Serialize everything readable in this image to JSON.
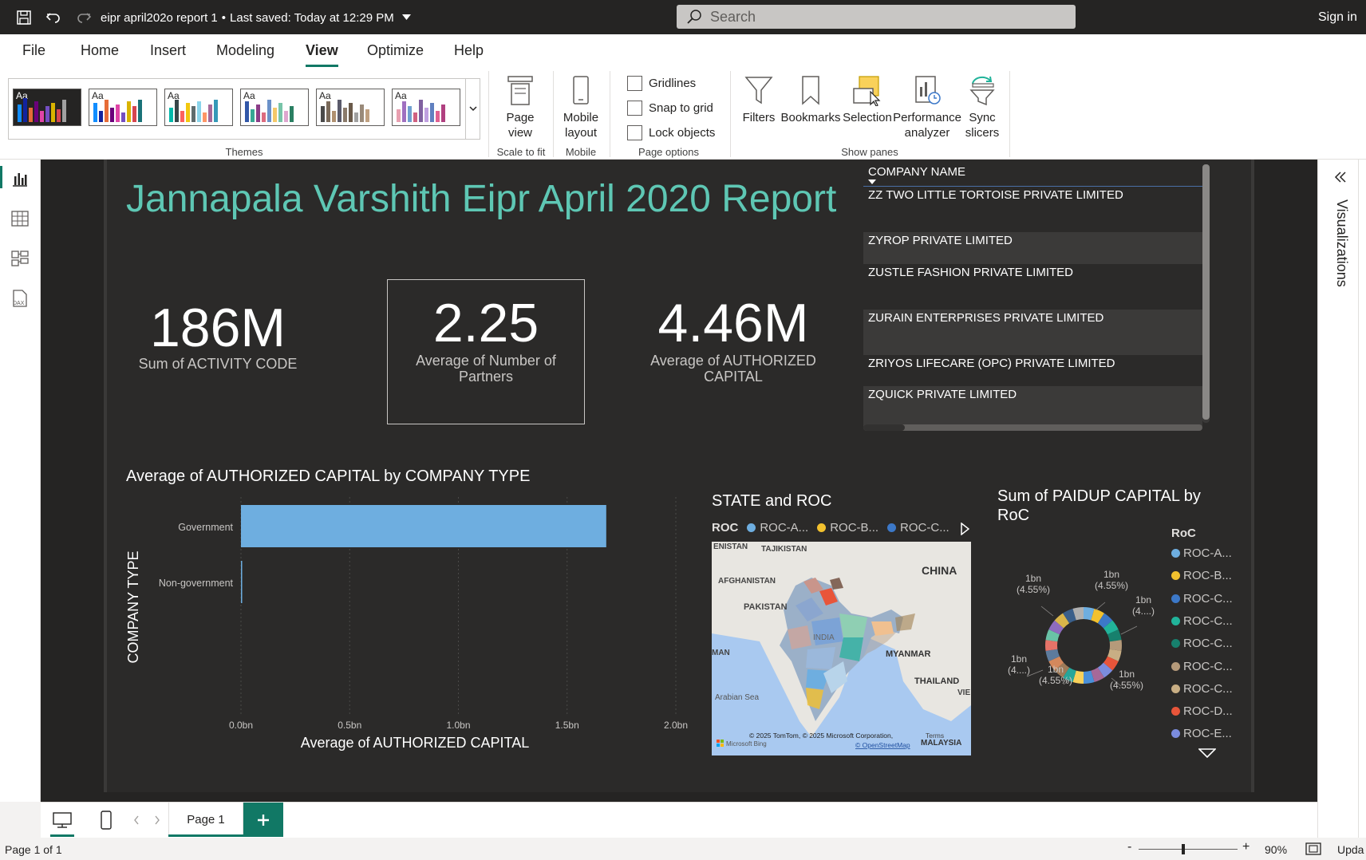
{
  "titlebar": {
    "file_title": "eipr april202o report 1",
    "saved": "Last saved: Today at 12:29 PM",
    "search_placeholder": "Search",
    "sign_in": "Sign in"
  },
  "menu": [
    "File",
    "Home",
    "Insert",
    "Modeling",
    "View",
    "Optimize",
    "Help"
  ],
  "menu_active": "View",
  "ribbon": {
    "themes_label": "Themes",
    "theme_aa": "Aa",
    "page_view": "Page view",
    "scale_to_fit": "Scale to fit",
    "mobile_layout": "Mobile layout",
    "mobile": "Mobile",
    "gridlines": "Gridlines",
    "snap_to_grid": "Snap to grid",
    "lock_objects": "Lock objects",
    "page_options": "Page options",
    "filters": "Filters",
    "bookmarks": "Bookmarks",
    "selection": "Selection",
    "performance": "Performance analyzer",
    "sync_slicers": "Sync slicers",
    "show_panes": "Show panes"
  },
  "report": {
    "title": "Jannapala Varshith Eipr April 2020 Report",
    "kpis": [
      {
        "value": "186M",
        "label": "Sum of ACTIVITY CODE"
      },
      {
        "value": "2.25",
        "label": "Average of Number of Partners"
      },
      {
        "value": "4.46M",
        "label": "Average of AUTHORIZED CAPITAL"
      }
    ],
    "table": {
      "header": "COMPANY NAME",
      "rows": [
        "ZZ TWO LITTLE TORTOISE PRIVATE LIMITED",
        "ZYROP PRIVATE LIMITED",
        "ZUSTLE FASHION PRIVATE LIMITED",
        "ZURAIN ENTERPRISES PRIVATE LIMITED",
        "ZRIYOS LIFECARE (OPC) PRIVATE LIMITED",
        "ZQUICK PRIVATE LIMITED"
      ]
    },
    "map": {
      "title": "STATE and ROC",
      "legend_title": "ROC",
      "legend": [
        "ROC-A...",
        "ROC-B...",
        "ROC-C..."
      ],
      "labels": [
        "ENISTAN",
        "TAJIKISTAN",
        "CHINA",
        "AFGHANISTAN",
        "PAKISTAN",
        "INDIA",
        "MYANMAR",
        "THAILAND",
        "Arabian Sea",
        "MAN",
        "VIE",
        "MALAYSIA"
      ],
      "copyright": "© 2025 TomTom, © 2025 Microsoft Corporation,",
      "terms": "Terms",
      "osm": "© OpenStreetMap",
      "bing": "Microsoft Bing"
    },
    "donut": {
      "title_line1": "Sum of PAIDUP CAPITAL by",
      "title_line2": "RoC",
      "legend_title": "RoC",
      "legend": [
        "ROC-A...",
        "ROC-B...",
        "ROC-C...",
        "ROC-C...",
        "ROC-C...",
        "ROC-C...",
        "ROC-C...",
        "ROC-D...",
        "ROC-E..."
      ],
      "labels": [
        {
          "a": "1bn",
          "b": "(4.55%)"
        },
        {
          "a": "1bn",
          "b": "(4.55%)"
        },
        {
          "a": "1bn",
          "b": "(4....)"
        },
        {
          "a": "1bn",
          "b": "(4....)"
        },
        {
          "a": "1bn",
          "b": "(4.55%)"
        },
        {
          "a": "1bn",
          "b": "(4.55%)"
        }
      ]
    }
  },
  "chart_data": {
    "type": "bar",
    "title": "Average of AUTHORIZED CAPITAL by COMPANY TYPE",
    "xlabel": "Average of AUTHORIZED CAPITAL",
    "ylabel": "COMPANY TYPE",
    "categories": [
      "Government",
      "Non-government"
    ],
    "values": [
      1.68,
      0.004
    ],
    "xlim": [
      0,
      2.0
    ],
    "x_ticks": [
      "0.0bn",
      "0.5bn",
      "1.0bn",
      "1.5bn",
      "2.0bn"
    ],
    "unit": "bn",
    "grid": true
  },
  "colors": {
    "accent": "#117865",
    "title_teal": "#5ec7b4",
    "bar": "#6eaee0",
    "canvas": "#2b2a29",
    "donut": [
      "#6eaee0",
      "#f2c12e",
      "#3c78c8",
      "#21b39a",
      "#17806d",
      "#b59a7a",
      "#c8ae84",
      "#e8553a",
      "#7b8cde",
      "#a66999",
      "#4a90d9",
      "#f9d15a",
      "#26a69a",
      "#9e7a58",
      "#d4885c",
      "#5d7b9d",
      "#e57368",
      "#69c2a6",
      "#8e6bbf",
      "#d9b54a",
      "#3a5f8a",
      "#b0b0b0"
    ]
  },
  "pages": {
    "current": "Page 1",
    "status": "Page 1 of 1",
    "zoom": "90%",
    "update": "Upda"
  },
  "rightpane": {
    "label": "Visualizations"
  }
}
